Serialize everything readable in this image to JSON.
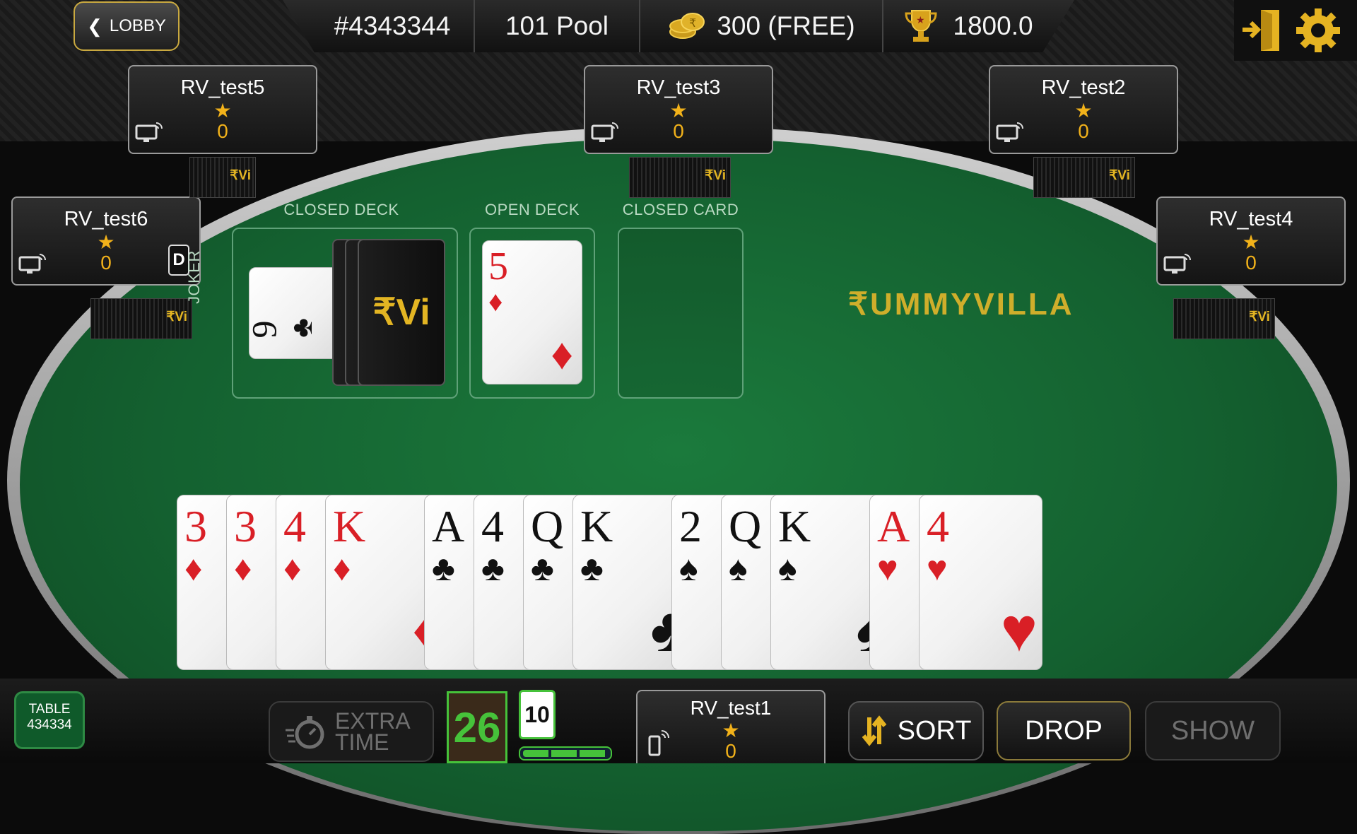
{
  "header": {
    "lobby_label": "LOBBY",
    "table_id": "#4343344",
    "game_type": "101 Pool",
    "entry": "300 (FREE)",
    "prize": "1800.0"
  },
  "players": [
    {
      "name": "RV_test5",
      "score": "0"
    },
    {
      "name": "RV_test3",
      "score": "0"
    },
    {
      "name": "RV_test2",
      "score": "0"
    },
    {
      "name": "RV_test6",
      "score": "0",
      "dealer_badge": "D"
    },
    {
      "name": "RV_test4",
      "score": "0"
    }
  ],
  "self_player": {
    "name": "RV_test1",
    "score": "0"
  },
  "deck": {
    "closed_deck_label": "CLOSED DECK",
    "open_deck_label": "OPEN DECK",
    "closed_card_label": "CLOSED CARD",
    "joker_label": "JOKER",
    "joker_card": {
      "rank": "9",
      "suit": "♣"
    },
    "open_card": {
      "rank": "5",
      "suit": "♦"
    },
    "back_logo": "₹Vi"
  },
  "brand": "₹UMMYVILLA",
  "hand": [
    {
      "rank": "3",
      "suit": "♦",
      "color": "red"
    },
    {
      "rank": "3",
      "suit": "♦",
      "color": "red"
    },
    {
      "rank": "4",
      "suit": "♦",
      "color": "red"
    },
    {
      "rank": "K",
      "suit": "♦",
      "color": "red"
    },
    {
      "rank": "A",
      "suit": "♣",
      "color": "black"
    },
    {
      "rank": "4",
      "suit": "♣",
      "color": "black"
    },
    {
      "rank": "Q",
      "suit": "♣",
      "color": "black"
    },
    {
      "rank": "K",
      "suit": "♣",
      "color": "black"
    },
    {
      "rank": "2",
      "suit": "♠",
      "color": "black"
    },
    {
      "rank": "Q",
      "suit": "♠",
      "color": "black"
    },
    {
      "rank": "K",
      "suit": "♠",
      "color": "black"
    },
    {
      "rank": "A",
      "suit": "♥",
      "color": "red"
    },
    {
      "rank": "4",
      "suit": "♥",
      "color": "red"
    }
  ],
  "bottom": {
    "table_label": "TABLE",
    "table_number": "434334",
    "extra_time_line1": "EXTRA",
    "extra_time_line2": "TIME",
    "timer": "26",
    "turn_count": "10",
    "sort_label": "SORT",
    "drop_label": "DROP",
    "show_label": "SHOW"
  },
  "colors": {
    "accent_gold": "#f2b21a",
    "felt_green": "#146130",
    "timer_green": "#46c23a"
  }
}
